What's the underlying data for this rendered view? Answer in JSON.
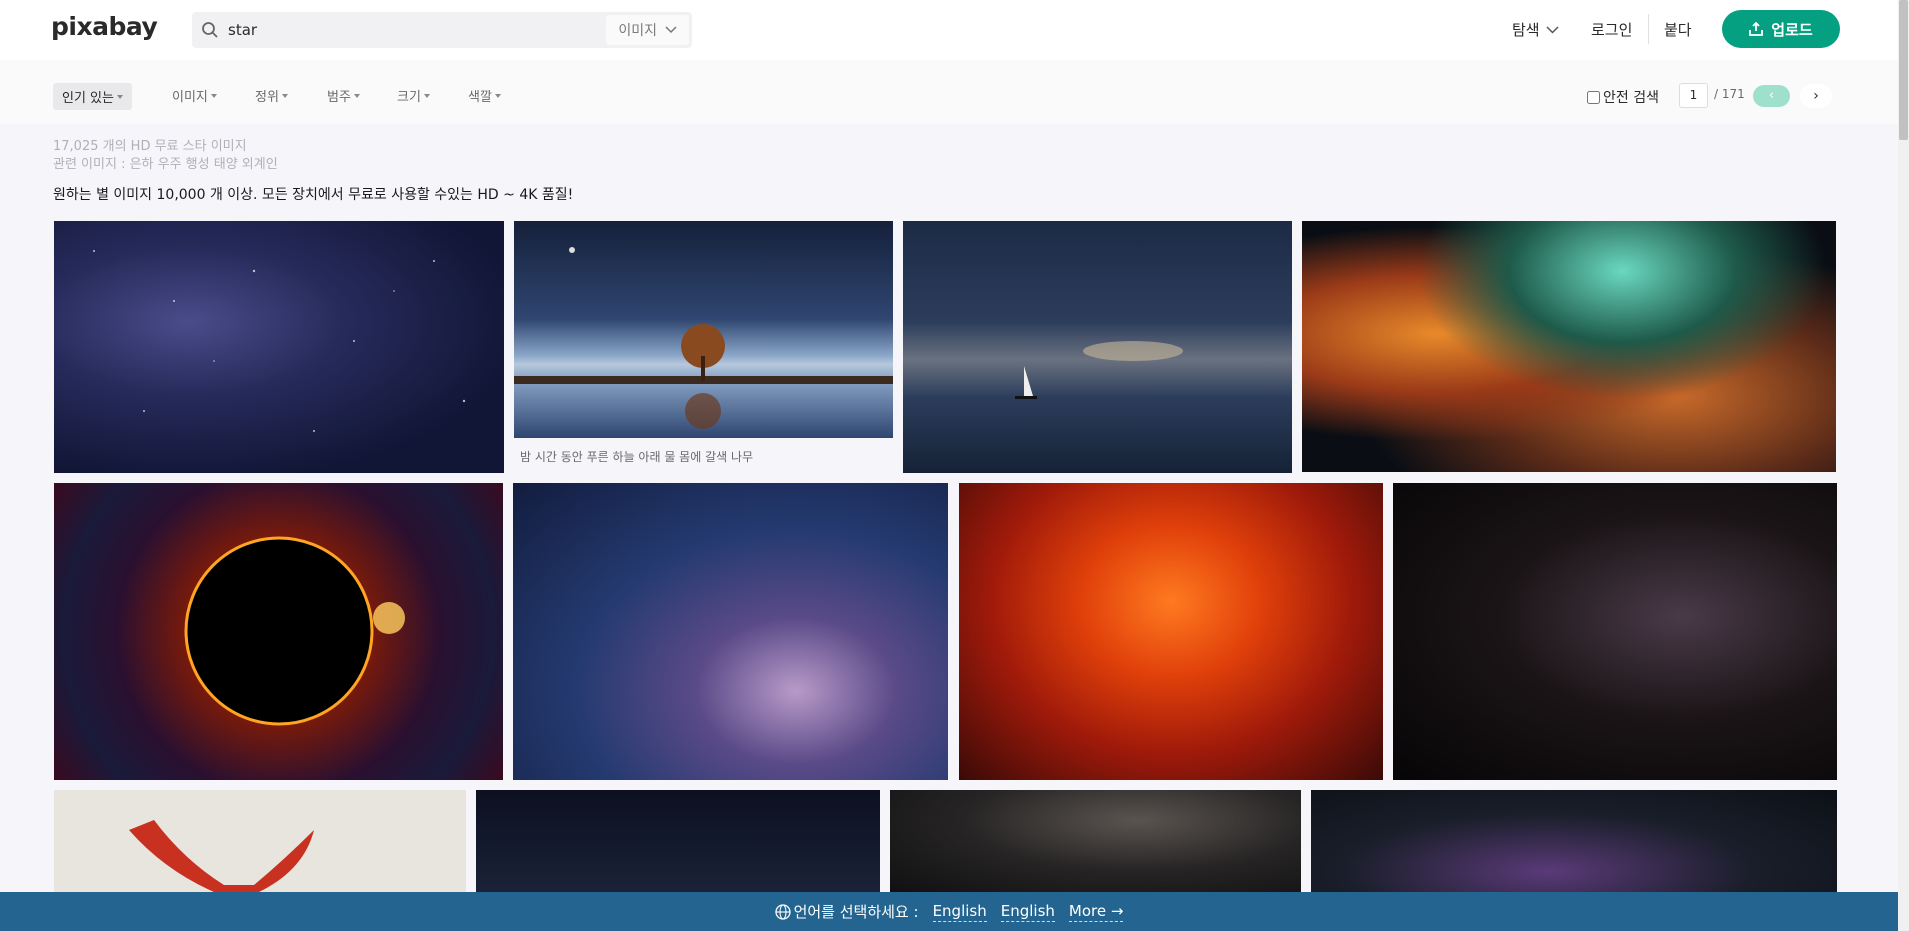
{
  "header": {
    "logo": "pixabay",
    "search_value": "star",
    "search_type": "이미지",
    "explore": "탐색",
    "login": "로그인",
    "join": "붙다",
    "upload": "업로드"
  },
  "filters": {
    "sort": "인기 있는",
    "items": [
      "이미지",
      "정위",
      "범주",
      "크기",
      "색깔"
    ],
    "safe_search": "안전 검색",
    "page": "1",
    "total_pages": "/ 171",
    "prev": "‹",
    "next": "›"
  },
  "info": {
    "count_line": "17,025 개의 HD 무료 스타 이미지",
    "related_line": "관련 이미지 : 은하 우주 행성 태양 외계인",
    "description": "원하는 별 이미지 10,000 개 이상. 모든 장치에서 무료로 사용할 수있는 HD ~ 4K 품질!"
  },
  "images": {
    "caption_tree": "밤 시간 동안 푸른 하늘 아래 물 몸에 갈색 나무"
  },
  "language_bar": {
    "prompt": "언어를 선택하세요 :",
    "option1": "English",
    "option2": "English",
    "more": "More →"
  },
  "colors": {
    "brand_green": "#05a081",
    "lang_bar": "#236590"
  }
}
